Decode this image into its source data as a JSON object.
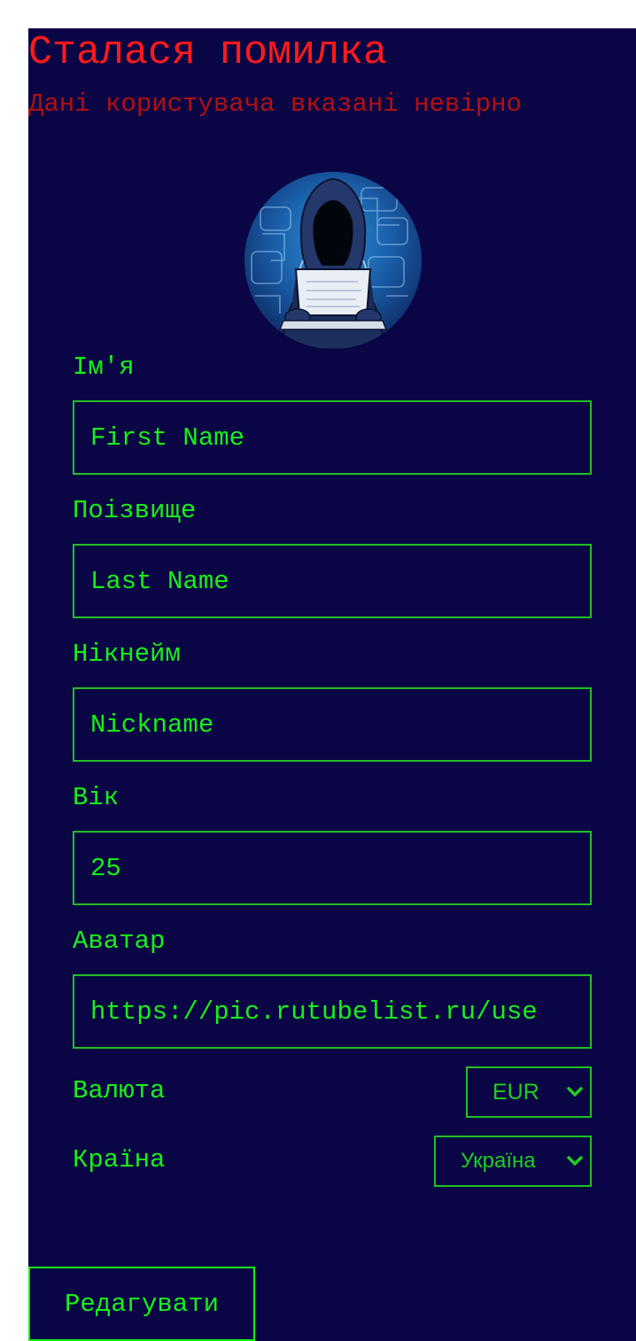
{
  "error": {
    "title": "Сталася помилка",
    "message": "Дані користувача вказані невірно"
  },
  "avatar": {
    "icon": "hooded-hacker-with-laptop"
  },
  "form": {
    "first_name": {
      "label": "Ім'я",
      "placeholder": "First Name",
      "value": ""
    },
    "last_name": {
      "label": "Поізвище",
      "placeholder": "Last Name",
      "value": ""
    },
    "nickname": {
      "label": "Нікнейм",
      "placeholder": "Nickname",
      "value": ""
    },
    "age": {
      "label": "Вік",
      "placeholder": "",
      "value": "25"
    },
    "avatar_url": {
      "label": "Аватар",
      "placeholder": "",
      "value": "https://pic.rutubelist.ru/use"
    },
    "currency": {
      "label": "Валюта",
      "selected": "EUR"
    },
    "country": {
      "label": "Країна",
      "selected": "Україна"
    },
    "submit_label": "Редагувати"
  },
  "colors": {
    "background": "#0a0646",
    "accent": "#17f017",
    "error": "#ff1a1a",
    "error_message": "#b40f0f"
  }
}
